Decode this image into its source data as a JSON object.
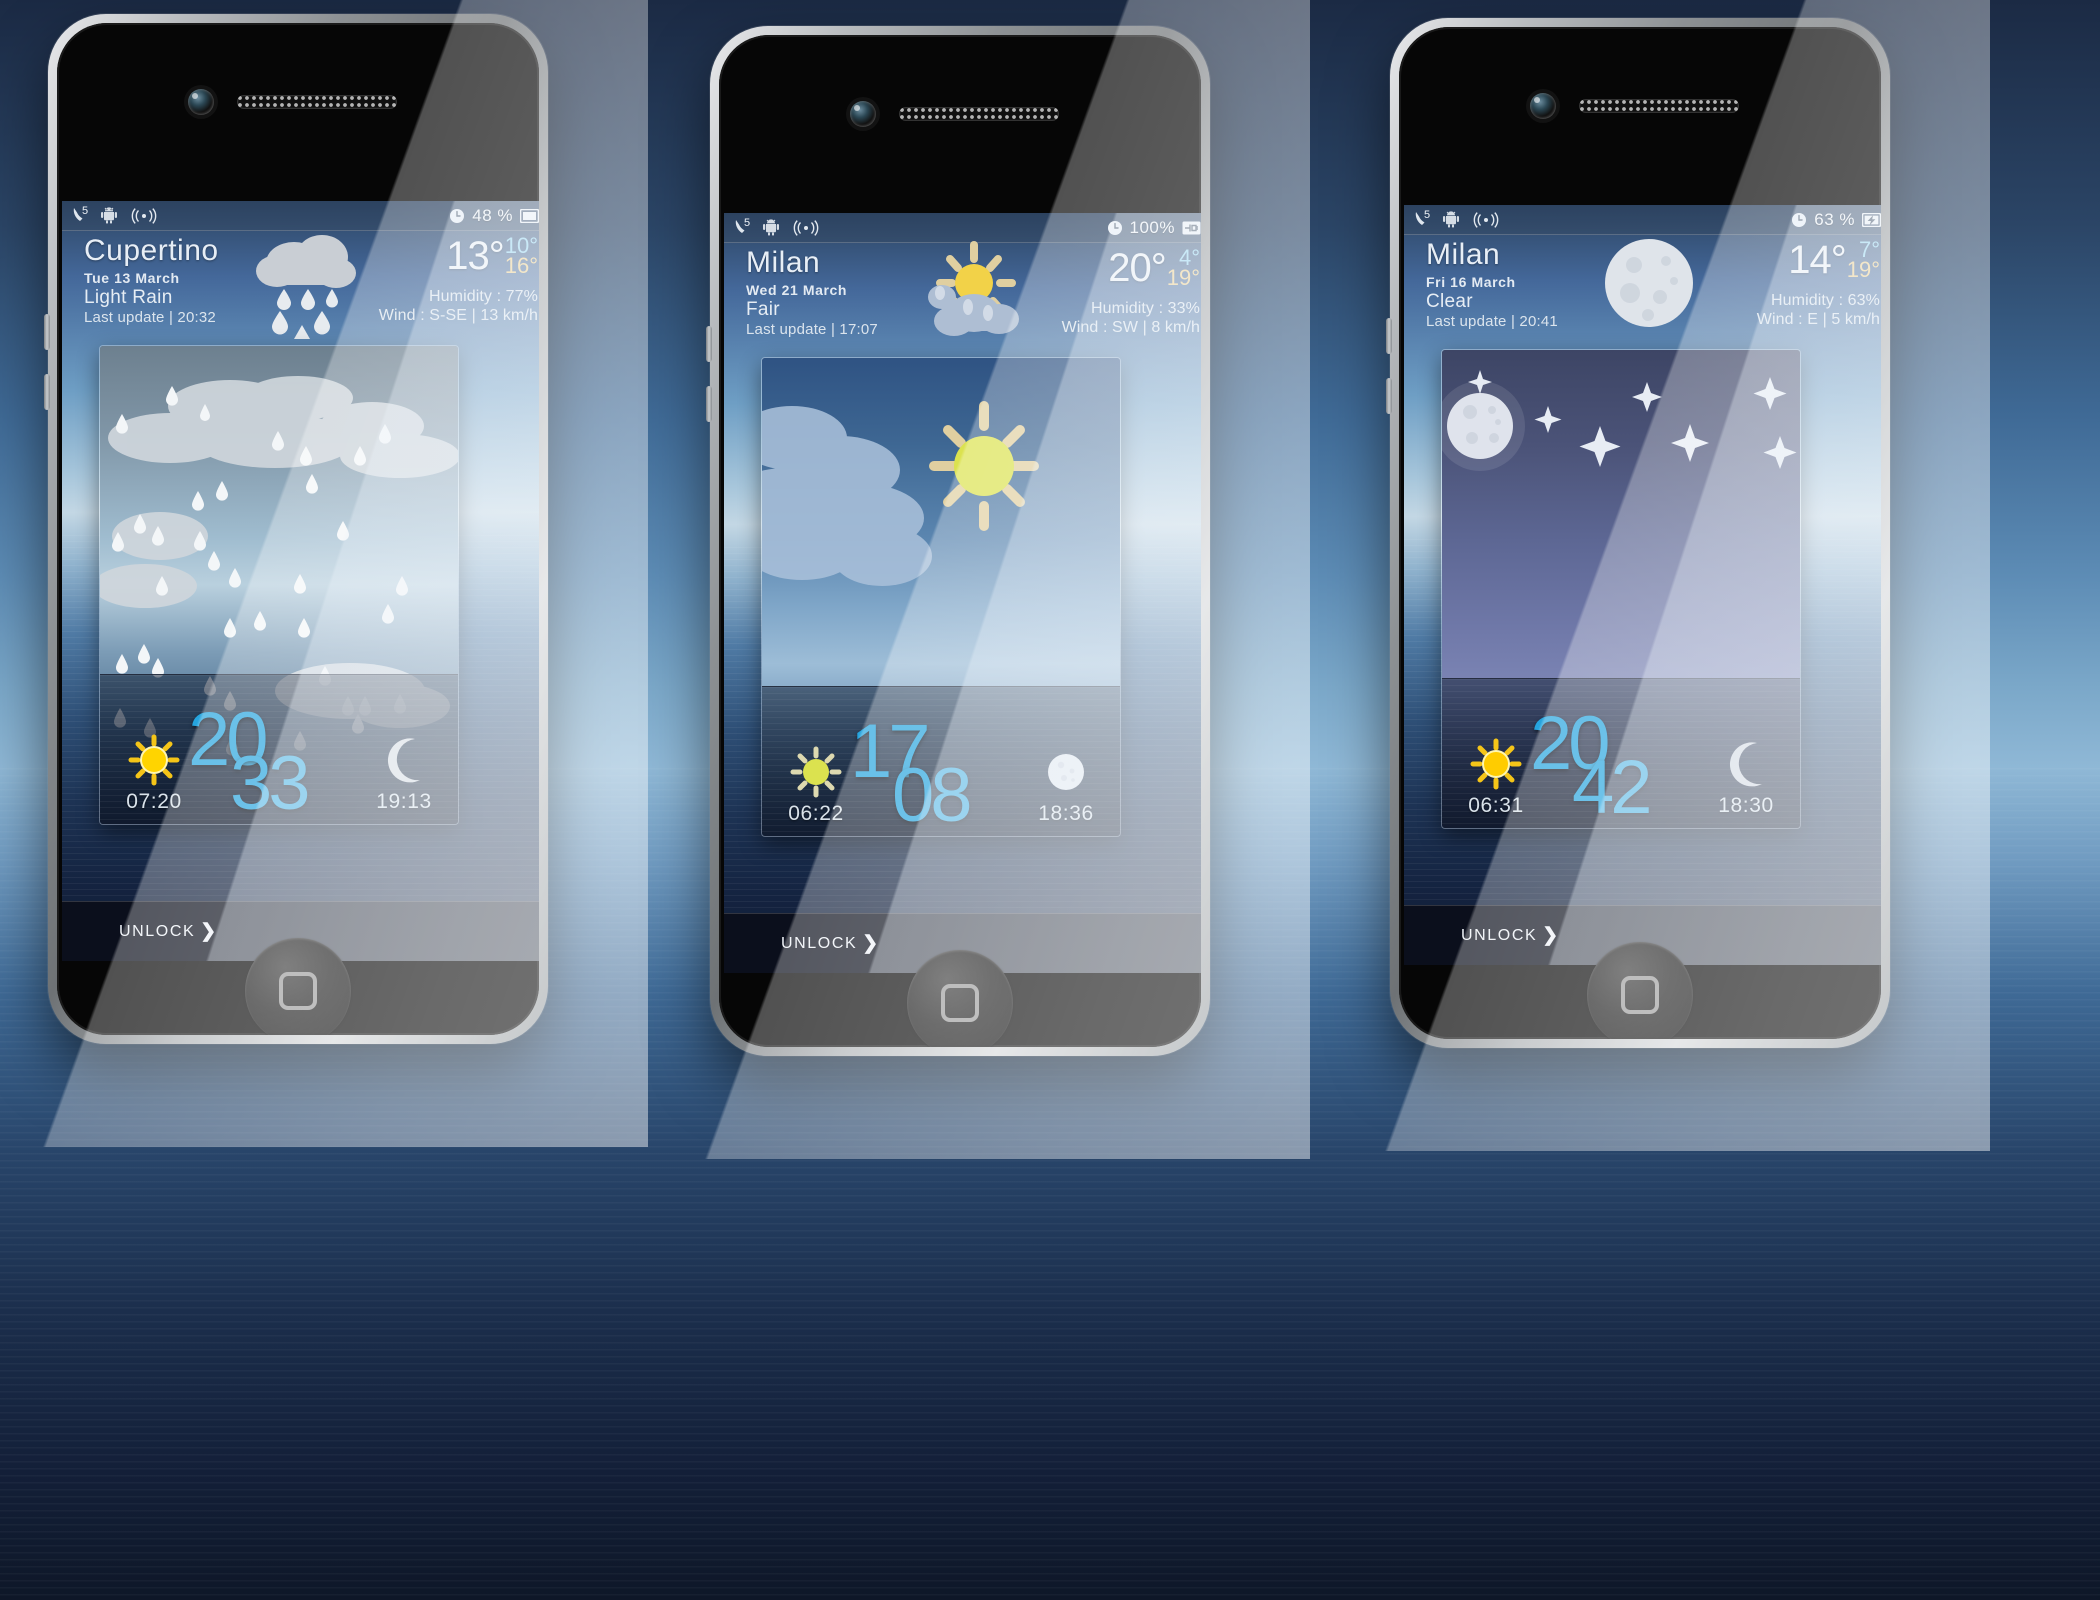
{
  "screen_overlay": {
    "unlock_label": "UNLOCK",
    "unlock_chevron": "❯"
  },
  "phones": [
    {
      "id": "phone-1",
      "statusbar": {
        "missed_calls": "5",
        "phone_icon": "phone-icon",
        "android_icon": "android-icon",
        "signal_icon": "signal-wave-icon",
        "clock_icon": "alarm-clock-icon",
        "battery_percent": "48 %",
        "battery_icon": "battery-icon",
        "battery_state": "discharging"
      },
      "weather": {
        "city": "Cupertino",
        "date": "Tue 13 March",
        "condition": "Light Rain",
        "last_update": "Last update | 20:32",
        "current_temp": "13°",
        "low_temp": "10°",
        "high_temp": "16°",
        "humidity": "Humidity : 77%",
        "wind": "Wind : S-SE | 13 km/h",
        "header_icon": "rain-cloud-icon"
      },
      "panel": {
        "scene": "rain",
        "scene_icon": "rain-clouds-scene"
      },
      "clock": {
        "sunrise_time": "07:20",
        "sunrise_icon": "sun-icon",
        "hours": "20",
        "minutes": "33",
        "sunset_time": "19:13",
        "sunset_icon": "crescent-moon-icon"
      }
    },
    {
      "id": "phone-2",
      "statusbar": {
        "missed_calls": "5",
        "phone_icon": "phone-icon",
        "android_icon": "android-icon",
        "signal_icon": "signal-wave-icon",
        "clock_icon": "alarm-clock-icon",
        "battery_percent": "100%",
        "battery_icon": "battery-charging-plug-icon",
        "battery_state": "charging"
      },
      "weather": {
        "city": "Milan",
        "date": "Wed 21 March",
        "condition": "Fair",
        "last_update": "Last update | 17:07",
        "current_temp": "20°",
        "low_temp": "4°",
        "high_temp": "19°",
        "humidity": "Humidity : 33%",
        "wind": "Wind : SW | 8 km/h",
        "header_icon": "sun-behind-cloud-icon"
      },
      "panel": {
        "scene": "fair",
        "scene_icon": "sun-and-clouds-scene"
      },
      "clock": {
        "sunrise_time": "06:22",
        "sunrise_icon": "sun-icon",
        "hours": "17",
        "minutes": "08",
        "sunset_time": "18:36",
        "sunset_icon": "full-moon-icon"
      }
    },
    {
      "id": "phone-3",
      "statusbar": {
        "missed_calls": "5",
        "phone_icon": "phone-icon",
        "android_icon": "android-icon",
        "signal_icon": "signal-wave-icon",
        "clock_icon": "alarm-clock-icon",
        "battery_percent": "63 %",
        "battery_icon": "battery-charging-bolt-icon",
        "battery_state": "charging"
      },
      "weather": {
        "city": "Milan",
        "date": "Fri 16 March",
        "condition": "Clear",
        "last_update": "Last update | 20:41",
        "current_temp": "14°",
        "low_temp": "7°",
        "high_temp": "19°",
        "humidity": "Humidity : 63%",
        "wind": "Wind : E | 5 km/h",
        "header_icon": "full-moon-icon"
      },
      "panel": {
        "scene": "clear",
        "scene_icon": "moon-and-stars-scene"
      },
      "clock": {
        "sunrise_time": "06:31",
        "sunrise_icon": "sun-icon",
        "hours": "20",
        "minutes": "42",
        "sunset_time": "18:30",
        "sunset_icon": "crescent-moon-icon"
      }
    }
  ],
  "colors": {
    "clock_blue": "#26a4de",
    "temp_low_blue": "#8fd4f0",
    "temp_high_gold": "#f2cf84",
    "statusbar_blue": "#2c4260",
    "panel_border": "#ffffff"
  }
}
